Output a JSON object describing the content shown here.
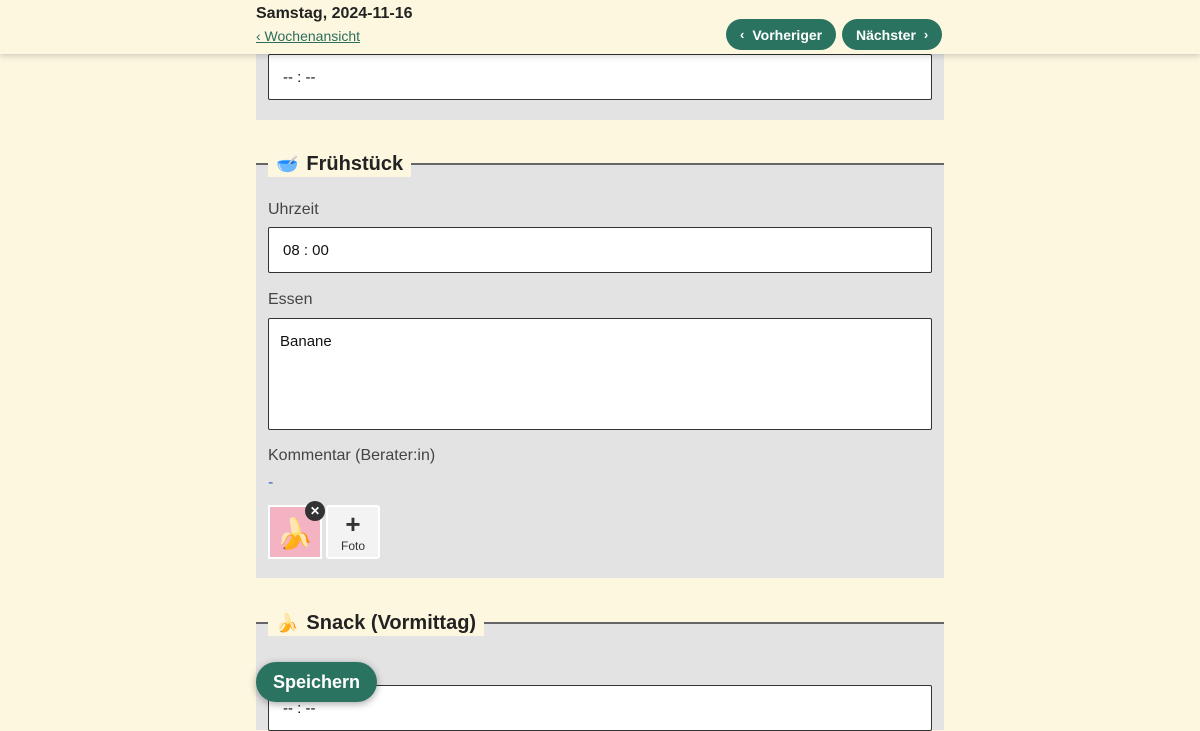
{
  "header": {
    "date_title": "Samstag, 2024-11-16",
    "back_link": "‹ Wochenansicht",
    "prev_label": "Vorheriger",
    "next_label": "Nächster",
    "prev_icon": "‹",
    "next_icon": "›"
  },
  "previous_section": {
    "time_value": "-- : --"
  },
  "breakfast": {
    "emoji": "🥣",
    "title": "Frühstück",
    "time_label": "Uhrzeit",
    "time_value": "08 : 00",
    "food_label": "Essen",
    "food_value": "Banane",
    "comment_label": "Kommentar (Berater:in)",
    "comment_value": "-",
    "photo_remove_icon": "✕",
    "add_photo_icon": "+",
    "add_photo_label": "Foto",
    "photo_emoji": "🍌"
  },
  "snack": {
    "emoji": "🍌",
    "title": "Snack (Vormittag)",
    "time_value": "-- : --"
  },
  "save_label": "Speichern",
  "colors": {
    "page_bg": "#fdf7e0",
    "panel_bg": "#e3e3e3",
    "accent": "#2b7361",
    "link": "#2b6e5c",
    "photo_bg": "#f3b3c3"
  }
}
